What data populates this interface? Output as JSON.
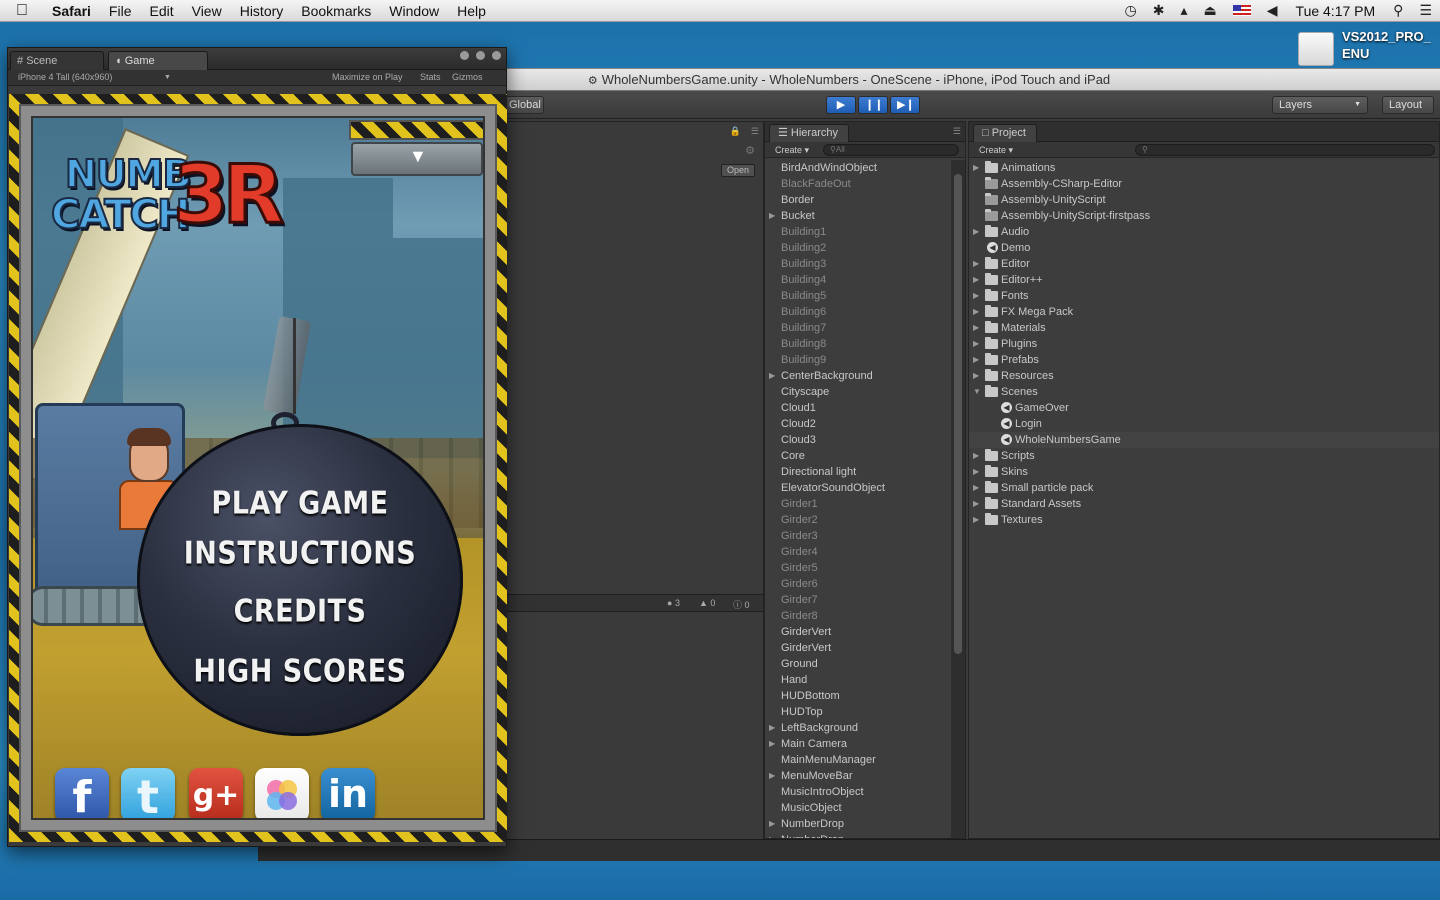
{
  "menubar": {
    "app": "Safari",
    "items": [
      "File",
      "Edit",
      "View",
      "History",
      "Bookmarks",
      "Window",
      "Help"
    ],
    "clock": "Tue 4:17 PM"
  },
  "desktop": {
    "drive_label": "VS2012_PRO_ENU"
  },
  "unity": {
    "window_title": "WholeNumbersGame.unity - WholeNumbers - OneScene - iPhone, iPod Touch and iPad",
    "toolbar": {
      "global": "Global",
      "layers": "Layers",
      "layout": "Layout"
    },
    "open_button": "Open",
    "console_counts": {
      "errors": "3",
      "warnings": "0",
      "messages": "0"
    },
    "hierarchy": {
      "title": "Hierarchy",
      "create": "Create",
      "search_placeholder": "All",
      "items": [
        {
          "label": "BirdAndWindObject",
          "dim": false,
          "arrow": false
        },
        {
          "label": "BlackFadeOut",
          "dim": true,
          "arrow": false
        },
        {
          "label": "Border",
          "dim": false,
          "arrow": false
        },
        {
          "label": "Bucket",
          "dim": false,
          "arrow": true
        },
        {
          "label": "Building1",
          "dim": true,
          "arrow": false
        },
        {
          "label": "Building2",
          "dim": true,
          "arrow": false
        },
        {
          "label": "Building3",
          "dim": true,
          "arrow": false
        },
        {
          "label": "Building4",
          "dim": true,
          "arrow": false
        },
        {
          "label": "Building5",
          "dim": true,
          "arrow": false
        },
        {
          "label": "Building6",
          "dim": true,
          "arrow": false
        },
        {
          "label": "Building7",
          "dim": true,
          "arrow": false
        },
        {
          "label": "Building8",
          "dim": true,
          "arrow": false
        },
        {
          "label": "Building9",
          "dim": true,
          "arrow": false
        },
        {
          "label": "CenterBackground",
          "dim": false,
          "arrow": true
        },
        {
          "label": "Cityscape",
          "dim": false,
          "arrow": false
        },
        {
          "label": "Cloud1",
          "dim": false,
          "arrow": false
        },
        {
          "label": "Cloud2",
          "dim": false,
          "arrow": false
        },
        {
          "label": "Cloud3",
          "dim": false,
          "arrow": false
        },
        {
          "label": "Core",
          "dim": false,
          "arrow": false
        },
        {
          "label": "Directional light",
          "dim": false,
          "arrow": false
        },
        {
          "label": "ElevatorSoundObject",
          "dim": false,
          "arrow": false
        },
        {
          "label": "Girder1",
          "dim": true,
          "arrow": false
        },
        {
          "label": "Girder2",
          "dim": true,
          "arrow": false
        },
        {
          "label": "Girder3",
          "dim": true,
          "arrow": false
        },
        {
          "label": "Girder4",
          "dim": true,
          "arrow": false
        },
        {
          "label": "Girder5",
          "dim": true,
          "arrow": false
        },
        {
          "label": "Girder6",
          "dim": true,
          "arrow": false
        },
        {
          "label": "Girder7",
          "dim": true,
          "arrow": false
        },
        {
          "label": "Girder8",
          "dim": true,
          "arrow": false
        },
        {
          "label": "GirderVert",
          "dim": false,
          "arrow": false
        },
        {
          "label": "GirderVert",
          "dim": false,
          "arrow": false
        },
        {
          "label": "Ground",
          "dim": false,
          "arrow": false
        },
        {
          "label": "Hand",
          "dim": false,
          "arrow": false
        },
        {
          "label": "HUDBottom",
          "dim": false,
          "arrow": false
        },
        {
          "label": "HUDTop",
          "dim": false,
          "arrow": false
        },
        {
          "label": "LeftBackground",
          "dim": false,
          "arrow": true
        },
        {
          "label": "Main Camera",
          "dim": false,
          "arrow": true
        },
        {
          "label": "MainMenuManager",
          "dim": false,
          "arrow": false
        },
        {
          "label": "MenuMoveBar",
          "dim": false,
          "arrow": true
        },
        {
          "label": "MusicIntroObject",
          "dim": false,
          "arrow": false
        },
        {
          "label": "MusicObject",
          "dim": false,
          "arrow": false
        },
        {
          "label": "NumberDrop",
          "dim": false,
          "arrow": true
        },
        {
          "label": "NumberDrop",
          "dim": false,
          "arrow": true
        }
      ]
    },
    "project": {
      "title": "Project",
      "create": "Create",
      "items": [
        {
          "label": "Animations",
          "type": "folder",
          "depth": 0,
          "arrow": "closed"
        },
        {
          "label": "Assembly-CSharp-Editor",
          "type": "asm",
          "depth": 0,
          "arrow": "none"
        },
        {
          "label": "Assembly-UnityScript",
          "type": "asm",
          "depth": 0,
          "arrow": "none"
        },
        {
          "label": "Assembly-UnityScript-firstpass",
          "type": "asm",
          "depth": 0,
          "arrow": "none"
        },
        {
          "label": "Audio",
          "type": "folder",
          "depth": 0,
          "arrow": "closed"
        },
        {
          "label": "Demo",
          "type": "scene",
          "depth": 0,
          "arrow": "none"
        },
        {
          "label": "Editor",
          "type": "folder",
          "depth": 0,
          "arrow": "closed"
        },
        {
          "label": "Editor++",
          "type": "folder",
          "depth": 0,
          "arrow": "closed"
        },
        {
          "label": "Fonts",
          "type": "folder",
          "depth": 0,
          "arrow": "closed"
        },
        {
          "label": "FX Mega Pack",
          "type": "folder",
          "depth": 0,
          "arrow": "closed"
        },
        {
          "label": "Materials",
          "type": "folder",
          "depth": 0,
          "arrow": "closed"
        },
        {
          "label": "Plugins",
          "type": "folder",
          "depth": 0,
          "arrow": "closed"
        },
        {
          "label": "Prefabs",
          "type": "folder",
          "depth": 0,
          "arrow": "closed"
        },
        {
          "label": "Resources",
          "type": "folder",
          "depth": 0,
          "arrow": "closed"
        },
        {
          "label": "Scenes",
          "type": "folder",
          "depth": 0,
          "arrow": "open"
        },
        {
          "label": "GameOver",
          "type": "scene",
          "depth": 1,
          "arrow": "none"
        },
        {
          "label": "Login",
          "type": "scene",
          "depth": 1,
          "arrow": "none"
        },
        {
          "label": "WholeNumbersGame",
          "type": "scene",
          "depth": 1,
          "arrow": "none",
          "selected": true
        },
        {
          "label": "Scripts",
          "type": "folder",
          "depth": 0,
          "arrow": "closed"
        },
        {
          "label": "Skins",
          "type": "folder",
          "depth": 0,
          "arrow": "closed"
        },
        {
          "label": "Small particle pack",
          "type": "folder",
          "depth": 0,
          "arrow": "closed"
        },
        {
          "label": "Standard Assets",
          "type": "folder",
          "depth": 0,
          "arrow": "closed"
        },
        {
          "label": "Textures",
          "type": "folder",
          "depth": 0,
          "arrow": "closed"
        }
      ]
    }
  },
  "game_window": {
    "tab_scene": "Scene",
    "tab_game": "Game",
    "aspect": "iPhone 4 Tall (640x960)",
    "maximize": "Maximize on Play",
    "stats": "Stats",
    "gizmos": "Gizmos",
    "logo": {
      "line1": "NUMB",
      "line2": "CATCH",
      "accent": "3R"
    },
    "menu": {
      "play": "PLAY GAME",
      "instructions": "INSTRUCTIONS",
      "credits": "CREDITS",
      "high_scores": "HIGH SCORES"
    },
    "social": {
      "facebook": "f",
      "twitter": "t",
      "google_plus": "g+",
      "linkedin": "in"
    }
  },
  "colors": {
    "unity_panel": "#3d3d3d",
    "play_blue": "#1f5db5",
    "hazard_yellow": "#e2c21c",
    "logo_red": "#e23b2a",
    "logo_blue": "#4fa6e0"
  }
}
